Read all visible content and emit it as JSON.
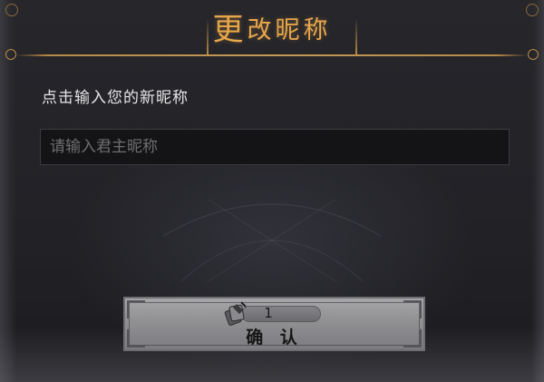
{
  "dialog": {
    "title_first": "更",
    "title_rest": "改昵称",
    "prompt": "点击输入您的新昵称",
    "input": {
      "value": "",
      "placeholder": "请输入君主昵称"
    },
    "confirm": {
      "cost": "1",
      "cost_icon": "rename-card-icon",
      "label": "确 认"
    }
  },
  "colors": {
    "title": "#e8a64a",
    "panel_bg": "#232328",
    "button_bg": "#909093"
  }
}
